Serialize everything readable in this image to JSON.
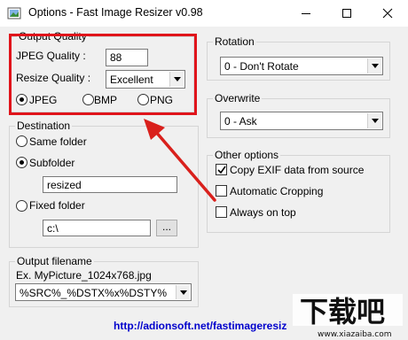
{
  "window": {
    "title": "Options - Fast Image Resizer v0.98",
    "minimize_icon": "minimize-icon",
    "maximize_icon": "maximize-icon",
    "close_icon": "close-icon"
  },
  "output_quality": {
    "legend": "Output Quality",
    "jpeg_quality_label": "JPEG Quality :",
    "jpeg_quality_value": "88",
    "resize_quality_label": "Resize Quality :",
    "resize_quality_value": "Excellent",
    "formats": [
      {
        "label": "JPEG",
        "checked": true
      },
      {
        "label": "BMP",
        "checked": false
      },
      {
        "label": "PNG",
        "checked": false
      }
    ]
  },
  "destination": {
    "legend": "Destination",
    "same_folder_label": "Same folder",
    "subfolder_label": "Subfolder",
    "subfolder_value": "resized",
    "fixed_folder_label": "Fixed folder",
    "fixed_folder_value": "c:\\",
    "browse_label": "...",
    "selected": "Subfolder"
  },
  "output_filename": {
    "legend": "Output filename",
    "example": "Ex. MyPicture_1024x768.jpg",
    "pattern_value": "%SRC%_%DSTX%x%DSTY%"
  },
  "rotation": {
    "legend": "Rotation",
    "value": "0 - Don't Rotate"
  },
  "overwrite": {
    "legend": "Overwrite",
    "value": "0 - Ask"
  },
  "other_options": {
    "legend": "Other options",
    "items": [
      {
        "label": "Copy EXIF data from source",
        "checked": true
      },
      {
        "label": "Automatic Cropping",
        "checked": false
      },
      {
        "label": "Always on top",
        "checked": false
      }
    ]
  },
  "footer": {
    "link_text": "http://adionsoft.net/fastimageresizer"
  },
  "annotation": {
    "highlight_color": "#e0141b",
    "arrow_color": "#d9201c"
  },
  "watermark": {
    "text": "下载吧",
    "url_text": "www.xiazaiba.com"
  }
}
